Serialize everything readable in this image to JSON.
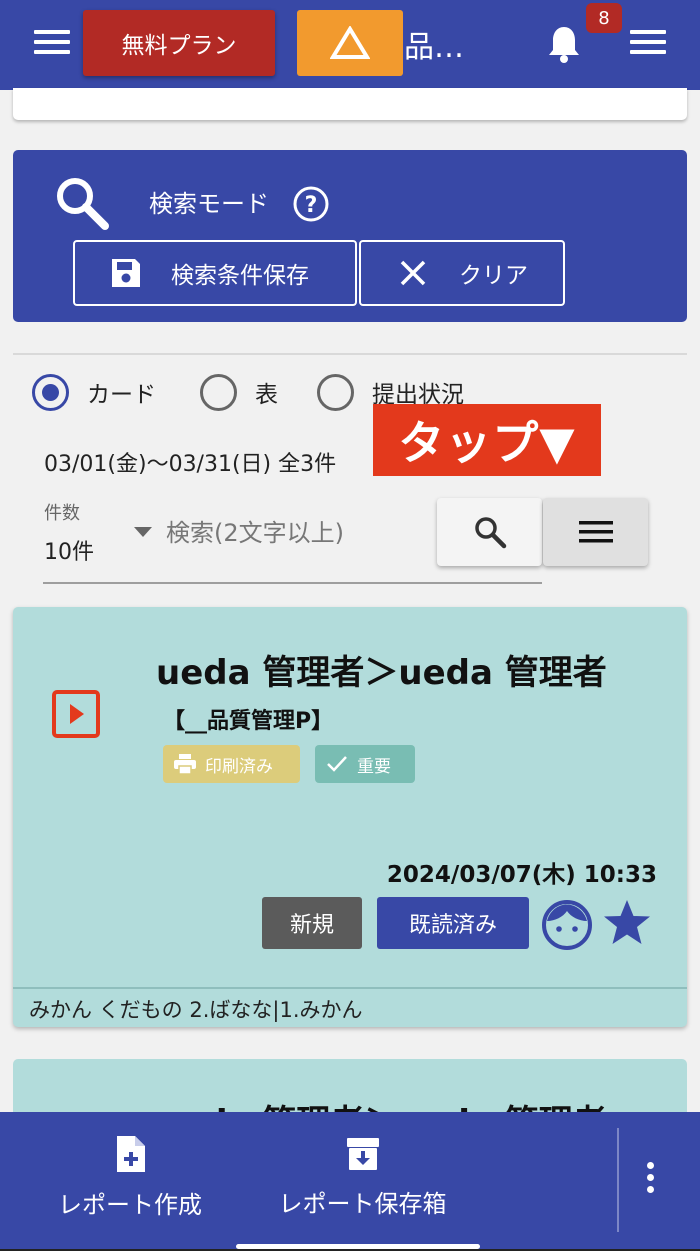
{
  "header": {
    "plan_label": "無料プラン",
    "title": "品…",
    "notification_count": "8"
  },
  "search": {
    "mode_label": "検索モード",
    "save_label": "検索条件保存",
    "clear_label": "クリア",
    "placeholder": "検索(2文字以上)"
  },
  "view": {
    "options": [
      "カード",
      "表",
      "提出状況"
    ],
    "selected": "カード"
  },
  "tap_label": "タップ▼",
  "date_range": "03/01(金)〜03/31(日) 全3件",
  "filter": {
    "count_label": "件数",
    "count_value": "10件"
  },
  "cards": [
    {
      "title": "ueda 管理者＞ueda 管理者",
      "group": "【__品質管理P】",
      "chips": [
        "印刷済み",
        "重要"
      ],
      "datetime": "2024/03/07(木) 10:33",
      "status_new": "新規",
      "status_read": "既読済み",
      "tags": "みかん くだもの 2.ばなな|1.みかん"
    },
    {
      "title": "ueda 管理者＞ueda 管理者"
    }
  ],
  "bottom_nav": {
    "create_label": "レポート作成",
    "archive_label": "レポート保存箱"
  },
  "colors": {
    "primary": "#3848a6",
    "plan_button": "#b22a25",
    "warning_button": "#f29a2e",
    "tap_label": "#e3391c",
    "card_bg": "#b2dcdb",
    "chip_printed": "#dccc7b",
    "chip_important": "#79bdb3"
  }
}
